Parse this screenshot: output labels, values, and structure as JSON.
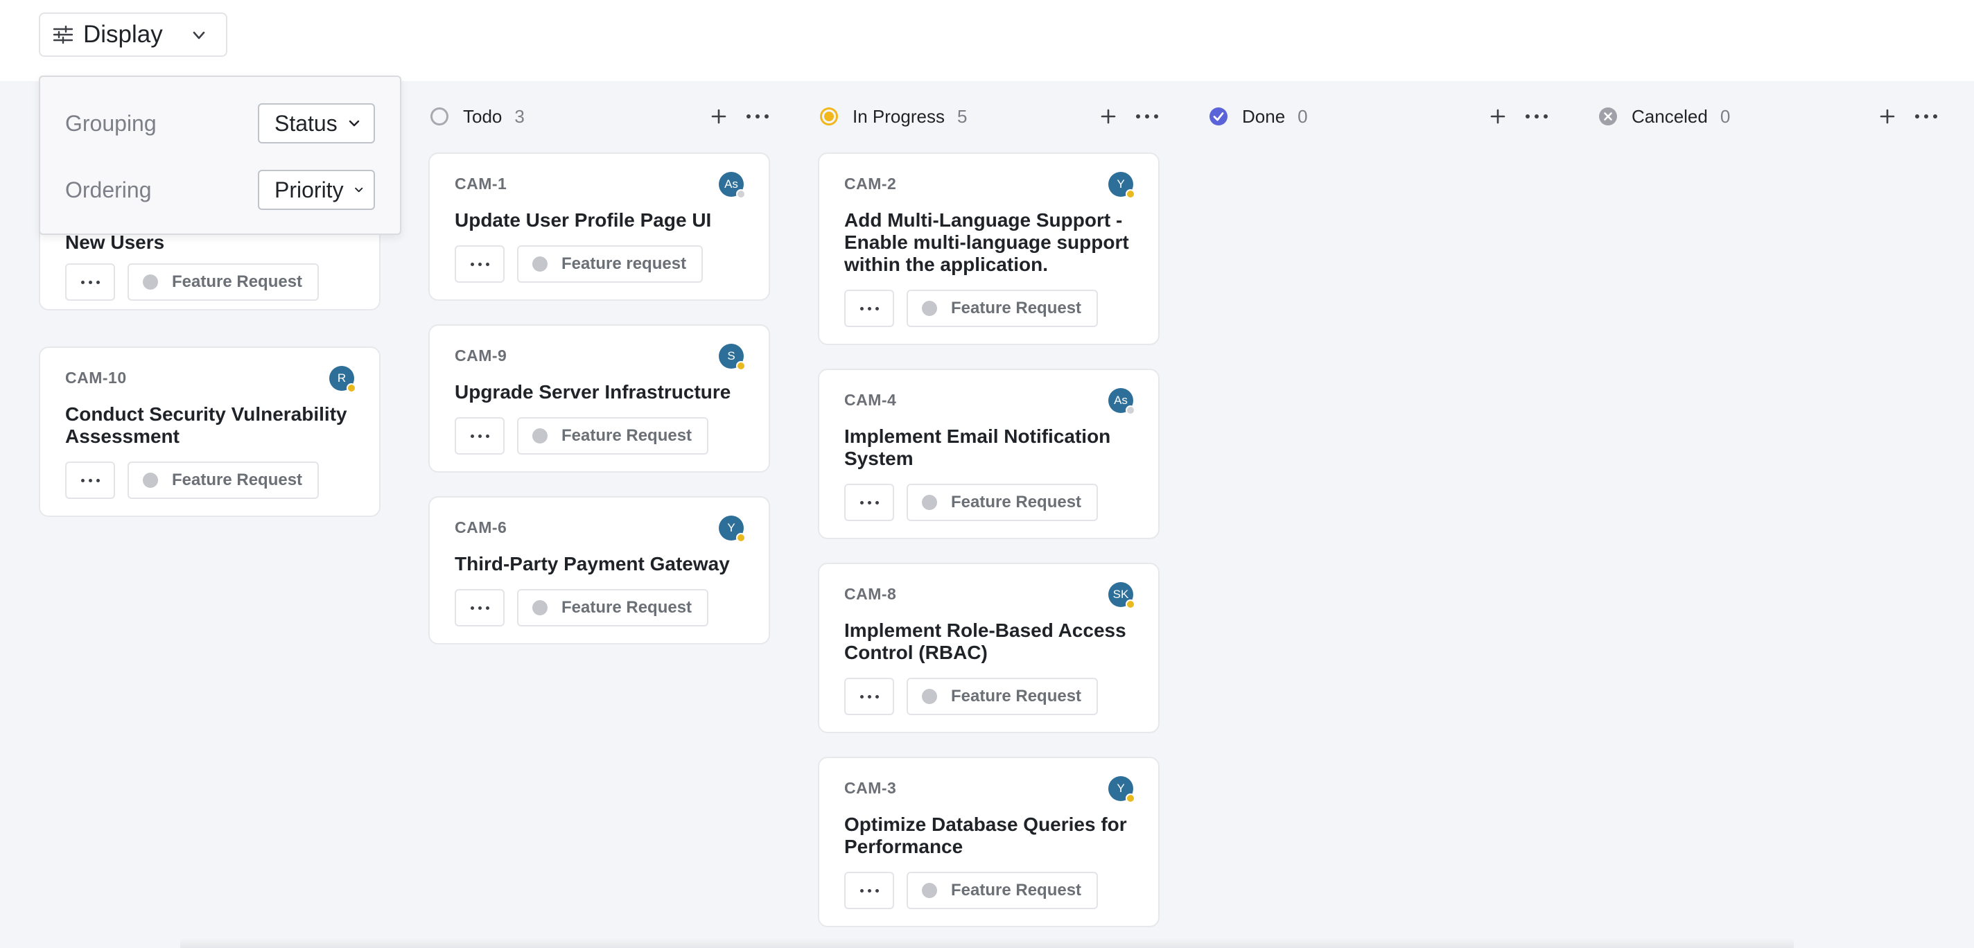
{
  "toolbar": {
    "display_label": "Display"
  },
  "display_popover": {
    "grouping_label": "Grouping",
    "grouping_value": "Status",
    "ordering_label": "Ordering",
    "ordering_value": "Priority"
  },
  "colors": {
    "avatar_bg": "#2e6f99",
    "in_progress": "#f2b71c",
    "done": "#5a63d8",
    "canceled": "#9ea1a8",
    "todo": "#a6a9b0",
    "status_dot_yellow": "#e9b920",
    "status_dot_gray": "#d0d2d6"
  },
  "columns": [
    {
      "title": "",
      "count": "",
      "cards": [
        {
          "id": "",
          "title": "New Users",
          "tag": "Feature Request"
        },
        {
          "id": "CAM-10",
          "title": "Conduct Security Vulnerability Assessment",
          "avatar": "R",
          "tag": "Feature Request"
        }
      ]
    },
    {
      "title": "Todo",
      "count": "3",
      "cards": [
        {
          "id": "CAM-1",
          "title": "Update User Profile Page UI",
          "avatar": "As",
          "tag": "Feature request"
        },
        {
          "id": "CAM-9",
          "title": "Upgrade Server Infrastructure",
          "avatar": "S",
          "tag": "Feature Request"
        },
        {
          "id": "CAM-6",
          "title": "Third-Party Payment Gateway",
          "avatar": "Y",
          "tag": "Feature Request"
        }
      ]
    },
    {
      "title": "In Progress",
      "count": "5",
      "cards": [
        {
          "id": "CAM-2",
          "title": "Add Multi-Language Support - Enable multi-language support within the application.",
          "avatar": "Y",
          "tag": "Feature Request"
        },
        {
          "id": "CAM-4",
          "title": "Implement Email Notification System",
          "avatar": "As",
          "tag": "Feature Request"
        },
        {
          "id": "CAM-8",
          "title": "Implement Role-Based Access Control (RBAC)",
          "avatar": "SK",
          "tag": "Feature Request"
        },
        {
          "id": "CAM-3",
          "title": "Optimize Database Queries for Performance",
          "avatar": "Y",
          "tag": "Feature Request"
        }
      ]
    },
    {
      "title": "Done",
      "count": "0",
      "cards": []
    },
    {
      "title": "Canceled",
      "count": "0",
      "cards": []
    }
  ]
}
